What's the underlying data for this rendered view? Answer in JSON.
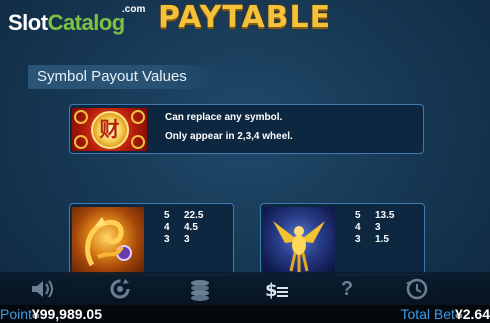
{
  "header": {
    "logo_slot": "Slot",
    "logo_catalog": "Catalog",
    "logo_com": ".com",
    "title": "PAYTABLE"
  },
  "section": {
    "label": "Symbol Payout Values"
  },
  "wild": {
    "icon": "fortune-wild-symbol",
    "glyph": "财",
    "line1": "Can replace any symbol.",
    "line2": "Only appear in 2,3,4 wheel."
  },
  "dragon": {
    "icon": "golden-dragon-symbol",
    "payouts": [
      {
        "count": "5",
        "value": "22.5"
      },
      {
        "count": "4",
        "value": "4.5"
      },
      {
        "count": "3",
        "value": "3"
      }
    ]
  },
  "phoenix": {
    "icon": "golden-phoenix-symbol",
    "payouts": [
      {
        "count": "5",
        "value": "13.5"
      },
      {
        "count": "4",
        "value": "3"
      },
      {
        "count": "3",
        "value": "1.5"
      }
    ]
  },
  "toolbar": {
    "sound_icon": "speaker-icon",
    "autoplay_icon": "autoplay-icon",
    "coins_icon": "coin-stack-icon",
    "paytable_icon": "dollar-list-icon",
    "help_icon": "question-icon",
    "history_icon": "history-icon",
    "help_glyph": "?"
  },
  "status": {
    "point_label": "Point",
    "point_value": "¥99,989.05",
    "bet_label": "Total Bet",
    "bet_value": "¥2.64"
  },
  "colors": {
    "title_gold": "#f3c13a",
    "status_label_blue": "#3d9be6",
    "panel_border": "#3f7bb0",
    "logo_green": "#7cc242"
  }
}
